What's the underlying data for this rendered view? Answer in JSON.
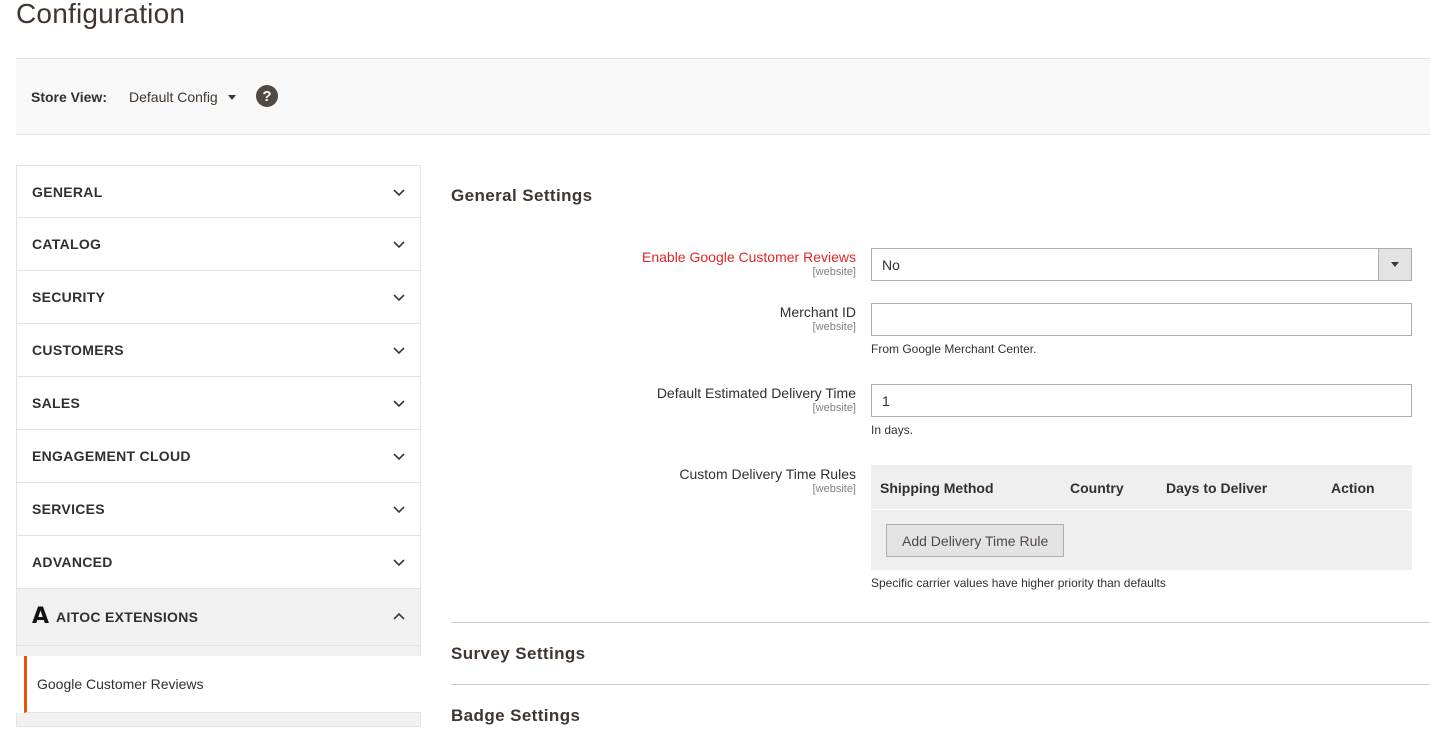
{
  "page": {
    "title": "Configuration"
  },
  "store_bar": {
    "label": "Store View:",
    "current_scope": "Default Config",
    "help_icon": "question-mark-icon"
  },
  "sidebar": {
    "items": [
      {
        "label": "GENERAL",
        "icon": "chevron-down-icon"
      },
      {
        "label": "CATALOG",
        "icon": "chevron-down-icon"
      },
      {
        "label": "SECURITY",
        "icon": "chevron-down-icon"
      },
      {
        "label": "CUSTOMERS",
        "icon": "chevron-down-icon"
      },
      {
        "label": "SALES",
        "icon": "chevron-down-icon"
      },
      {
        "label": "ENGAGEMENT CLOUD",
        "icon": "chevron-down-icon"
      },
      {
        "label": "SERVICES",
        "icon": "chevron-down-icon"
      },
      {
        "label": "ADVANCED",
        "icon": "chevron-down-icon"
      }
    ],
    "open_group": {
      "logo": "A",
      "label": "AITOC EXTENSIONS",
      "icon": "chevron-up-icon"
    },
    "active_subitem": "Google Customer Reviews",
    "active_accent_color": "#eb5202"
  },
  "general_settings": {
    "title": "General Settings",
    "fields": {
      "enable": {
        "label": "Enable Google Customer Reviews",
        "scope": "[website]",
        "value": "No",
        "label_color": "#e22626"
      },
      "merchant_id": {
        "label": "Merchant ID",
        "scope": "[website]",
        "value": "",
        "note": "From Google Merchant Center."
      },
      "delivery_time": {
        "label": "Default Estimated Delivery Time",
        "scope": "[website]",
        "value": "1",
        "note": "In days."
      },
      "custom_rules": {
        "label": "Custom Delivery Time Rules",
        "scope": "[website]",
        "columns": [
          "Shipping Method",
          "Country",
          "Days to Deliver",
          "Action"
        ],
        "add_button": "Add Delivery Time Rule",
        "note": "Specific carrier values have higher priority than defaults"
      }
    }
  },
  "collapsed_sections": [
    "Survey Settings",
    "Badge Settings"
  ]
}
